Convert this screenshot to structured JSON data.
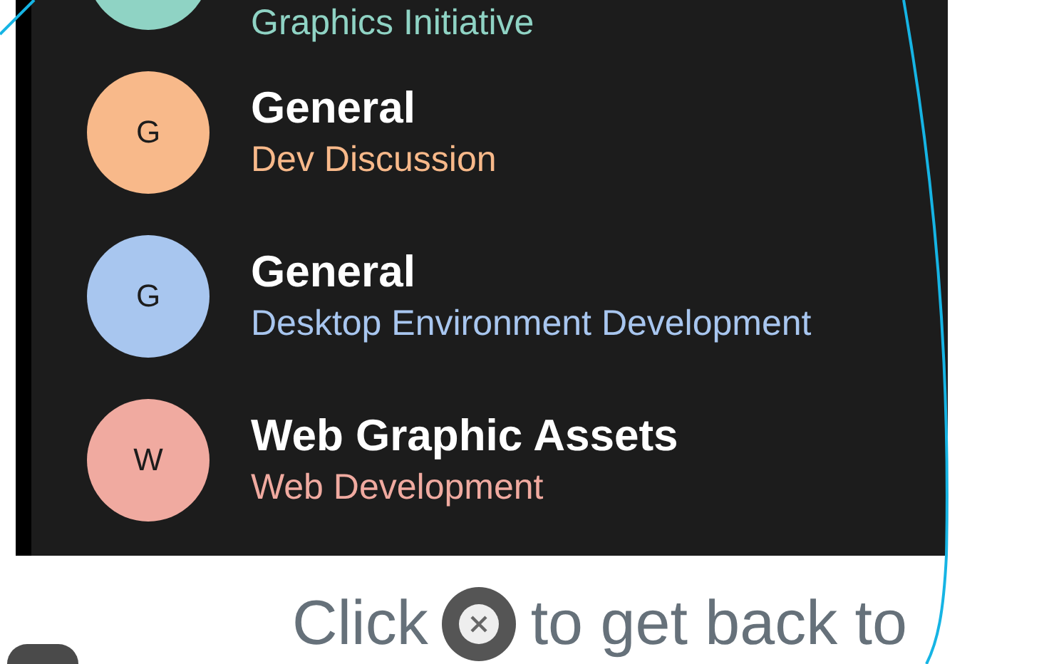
{
  "channels": [
    {
      "subtitle": "Graphics Initiative",
      "color": "#8fd3c4"
    },
    {
      "letter": "G",
      "title": "General",
      "subtitle": "Dev Discussion",
      "color": "#f8b98a"
    },
    {
      "letter": "G",
      "title": "General",
      "subtitle": "Desktop Environment Development",
      "color": "#a8c6ef"
    },
    {
      "letter": "W",
      "title": "Web Graphic Assets",
      "subtitle": "Web Development",
      "color": "#f0aaa0"
    }
  ],
  "hint": {
    "before": "Click",
    "after": "to get back to"
  }
}
